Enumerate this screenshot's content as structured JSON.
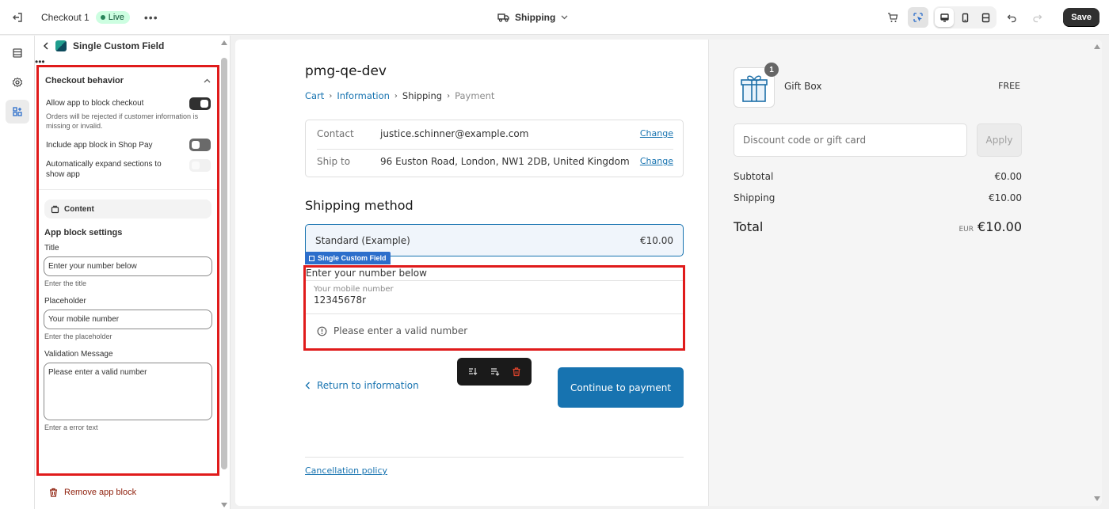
{
  "topbar": {
    "checkout_name": "Checkout 1",
    "status_badge": "Live",
    "page_select": "Shipping",
    "save_label": "Save"
  },
  "sidebar": {
    "block_name": "Single Custom Field",
    "section_title": "Checkout behavior",
    "options": [
      {
        "label": "Allow app to block checkout",
        "help": "Orders will be rejected if customer information is missing or invalid.",
        "state": "on"
      },
      {
        "label": "Include app block in Shop Pay",
        "state": "off"
      },
      {
        "label": "Automatically expand sections to show app",
        "state": "disabled"
      }
    ],
    "content_label": "Content",
    "settings_title": "App block settings",
    "fields": {
      "title": {
        "label": "Title",
        "value": "Enter your number below",
        "help": "Enter the title"
      },
      "placeholder": {
        "label": "Placeholder",
        "value": "Your mobile number",
        "help": "Enter the placeholder"
      },
      "validation": {
        "label": "Validation Message",
        "value": "Please enter a valid number",
        "help": "Enter a error text"
      }
    },
    "remove_label": "Remove app block"
  },
  "checkout": {
    "shop_name": "pmg-qe-dev",
    "breadcrumbs": [
      "Cart",
      "Information",
      "Shipping",
      "Payment"
    ],
    "review": [
      {
        "label": "Contact",
        "value": "justice.schinner@example.com",
        "action": "Change"
      },
      {
        "label": "Ship to",
        "value": "96 Euston Road, London, NW1 2DB, United Kingdom",
        "action": "Change"
      }
    ],
    "shipping_heading": "Shipping method",
    "shipping_option": {
      "name": "Standard (Example)",
      "price": "€10.00"
    },
    "block_tag": "Single Custom Field",
    "block": {
      "title": "Enter your number below",
      "placeholder": "Your mobile number",
      "value": "12345678r",
      "error": "Please enter a valid number"
    },
    "return_label": "Return to information",
    "continue_label": "Continue to payment",
    "policy_label": "Cancellation policy"
  },
  "summary": {
    "product": {
      "name": "Gift Box",
      "price": "FREE",
      "quantity": "1"
    },
    "discount_placeholder": "Discount code or gift card",
    "apply_label": "Apply",
    "subtotal_label": "Subtotal",
    "subtotal_value": "€0.00",
    "shipping_label": "Shipping",
    "shipping_value": "€10.00",
    "total_label": "Total",
    "currency": "EUR",
    "total_value": "€10.00"
  },
  "colors": {
    "accent": "#1773b0",
    "highlight": "#e01b1b",
    "block_tag": "#2c6ecb"
  }
}
